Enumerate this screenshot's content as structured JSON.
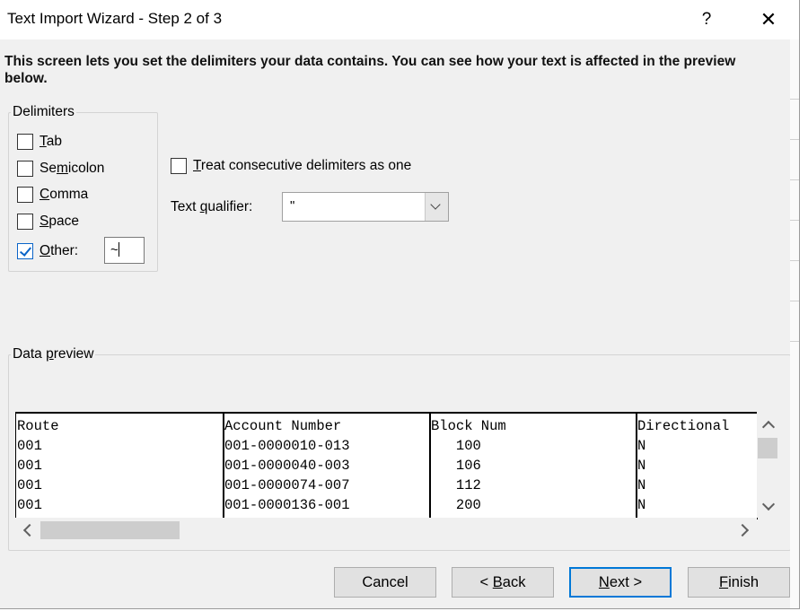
{
  "window": {
    "title": "Text Import Wizard - Step 2 of 3",
    "help": "?",
    "close": "✕"
  },
  "description": "This screen lets you set the delimiters your data contains.  You can see how your text is affected in the preview below.",
  "delimiters": {
    "legend": "Delimiters",
    "tab": {
      "pre": "",
      "key": "T",
      "post": "ab",
      "checked": false
    },
    "semicolon": {
      "pre": "Se",
      "key": "m",
      "post": "icolon",
      "checked": false
    },
    "comma": {
      "pre": "",
      "key": "C",
      "post": "omma",
      "checked": false
    },
    "space": {
      "pre": "",
      "key": "S",
      "post": "pace",
      "checked": false
    },
    "other": {
      "pre": "",
      "key": "O",
      "post": "ther:",
      "checked": true,
      "value": "~"
    }
  },
  "treat_consecutive": {
    "pre": "",
    "key": "T",
    "post": "reat consecutive delimiters as one",
    "checked": false
  },
  "text_qualifier": {
    "pre": "Text ",
    "key": "q",
    "post": "ualifier:",
    "value": "\""
  },
  "data_preview": {
    "legend_pre": "Data ",
    "legend_key": "p",
    "legend_post": "review",
    "columns": [
      "Route",
      "Account Number",
      "Block Num",
      "Directional"
    ],
    "rows": [
      [
        "001",
        "001-0000010-013",
        "   100",
        "N"
      ],
      [
        "001",
        "001-0000040-003",
        "   106",
        "N"
      ],
      [
        "001",
        "001-0000074-007",
        "   112",
        "N"
      ],
      [
        "001",
        "001-0000136-001",
        "   200",
        "N"
      ]
    ]
  },
  "buttons": {
    "cancel": "Cancel",
    "back": {
      "pre": "< ",
      "key": "B",
      "post": "ack"
    },
    "next": {
      "pre": "",
      "key": "N",
      "post": "ext >"
    },
    "finish": {
      "pre": "",
      "key": "F",
      "post": "inish"
    }
  }
}
